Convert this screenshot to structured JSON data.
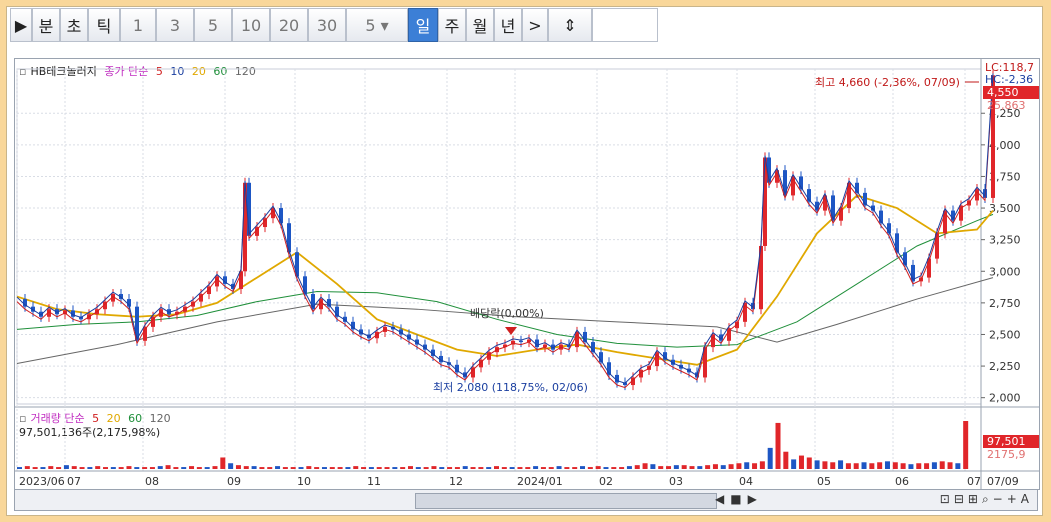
{
  "toolbar": {
    "items": [
      {
        "label": "▶",
        "active": false
      },
      {
        "label": "분",
        "active": false
      },
      {
        "label": "초",
        "active": false
      },
      {
        "label": "틱",
        "active": false
      },
      {
        "label": "1",
        "active": false
      },
      {
        "label": "3",
        "active": false
      },
      {
        "label": "5",
        "active": false
      },
      {
        "label": "10",
        "active": false
      },
      {
        "label": "20",
        "active": false
      },
      {
        "label": "30",
        "active": false
      },
      {
        "label": "5",
        "active": false
      },
      {
        "label": "일",
        "active": true
      },
      {
        "label": "주",
        "active": false
      },
      {
        "label": "월",
        "active": false
      },
      {
        "label": "년",
        "active": false
      },
      {
        "label": ">",
        "active": false
      },
      {
        "label": "⇕",
        "active": false
      }
    ]
  },
  "price_legend": {
    "title": "HB테크놀러지",
    "ma_label": "종가 단순",
    "periods": [
      "5",
      "10",
      "20",
      "60",
      "120"
    ],
    "colors": [
      "#d01f1f",
      "#1b3fa0",
      "#e0a800",
      "#1f8f3a",
      "#666666"
    ]
  },
  "volume_legend": {
    "title": "거래량 단순",
    "periods": [
      "5",
      "20",
      "60",
      "120"
    ],
    "value": "97,501,136주(2,175,98%)"
  },
  "annotations": {
    "high": "최고 4,660 (-2,36%, 07/09)",
    "low": "최저 2,080 (118,75%, 02/06)",
    "dividend": "배당락(0,00%)"
  },
  "right_labels": {
    "lc": "LC:118,7",
    "hc": "HC:-2,36",
    "price_now": "4,550",
    "pct": "25,863",
    "vol_now": "97,501",
    "vol_pct": "2175,9"
  },
  "colors": {
    "up": "#e0262a",
    "down": "#1d56c4",
    "grid": "#d9dde5"
  },
  "chart_data": {
    "type": "line",
    "y_ticks": [
      "4,250",
      "4,000",
      "3,750",
      "3,500",
      "3,250",
      "3,000",
      "2,750",
      "2,500",
      "2,250",
      "2,000"
    ],
    "ylim": [
      1950,
      4600
    ],
    "x_labels": [
      "2023/06",
      "07",
      "08",
      "09",
      "10",
      "11",
      "12",
      "2024/01",
      "02",
      "03",
      "04",
      "05",
      "06",
      "07",
      "07/09"
    ],
    "price_series": [
      [
        0,
        2780
      ],
      [
        8,
        2720
      ],
      [
        16,
        2680
      ],
      [
        24,
        2640
      ],
      [
        32,
        2700
      ],
      [
        40,
        2660
      ],
      [
        48,
        2690
      ],
      [
        56,
        2640
      ],
      [
        64,
        2620
      ],
      [
        72,
        2660
      ],
      [
        80,
        2700
      ],
      [
        88,
        2760
      ],
      [
        96,
        2820
      ],
      [
        104,
        2780
      ],
      [
        112,
        2720
      ],
      [
        120,
        2450
      ],
      [
        128,
        2560
      ],
      [
        136,
        2640
      ],
      [
        144,
        2700
      ],
      [
        152,
        2660
      ],
      [
        160,
        2680
      ],
      [
        168,
        2720
      ],
      [
        176,
        2760
      ],
      [
        184,
        2820
      ],
      [
        192,
        2880
      ],
      [
        200,
        2960
      ],
      [
        208,
        2900
      ],
      [
        216,
        2860
      ],
      [
        224,
        3000
      ],
      [
        228,
        3700
      ],
      [
        232,
        3280
      ],
      [
        240,
        3350
      ],
      [
        248,
        3420
      ],
      [
        256,
        3500
      ],
      [
        264,
        3380
      ],
      [
        272,
        3150
      ],
      [
        280,
        2960
      ],
      [
        288,
        2820
      ],
      [
        296,
        2700
      ],
      [
        304,
        2780
      ],
      [
        312,
        2720
      ],
      [
        320,
        2640
      ],
      [
        328,
        2600
      ],
      [
        336,
        2540
      ],
      [
        344,
        2500
      ],
      [
        352,
        2470
      ],
      [
        360,
        2520
      ],
      [
        368,
        2560
      ],
      [
        376,
        2540
      ],
      [
        384,
        2500
      ],
      [
        392,
        2460
      ],
      [
        400,
        2420
      ],
      [
        408,
        2380
      ],
      [
        416,
        2330
      ],
      [
        424,
        2280
      ],
      [
        432,
        2260
      ],
      [
        440,
        2200
      ],
      [
        448,
        2160
      ],
      [
        456,
        2240
      ],
      [
        464,
        2300
      ],
      [
        472,
        2360
      ],
      [
        480,
        2400
      ],
      [
        488,
        2420
      ],
      [
        496,
        2450
      ],
      [
        504,
        2440
      ],
      [
        512,
        2460
      ],
      [
        520,
        2400
      ],
      [
        528,
        2420
      ],
      [
        536,
        2380
      ],
      [
        544,
        2420
      ],
      [
        552,
        2400
      ],
      [
        560,
        2520
      ],
      [
        568,
        2440
      ],
      [
        576,
        2360
      ],
      [
        584,
        2280
      ],
      [
        592,
        2180
      ],
      [
        600,
        2120
      ],
      [
        608,
        2100
      ],
      [
        616,
        2160
      ],
      [
        624,
        2220
      ],
      [
        632,
        2250
      ],
      [
        640,
        2360
      ],
      [
        648,
        2300
      ],
      [
        656,
        2260
      ],
      [
        664,
        2230
      ],
      [
        672,
        2200
      ],
      [
        680,
        2160
      ],
      [
        688,
        2400
      ],
      [
        696,
        2500
      ],
      [
        704,
        2450
      ],
      [
        712,
        2550
      ],
      [
        720,
        2600
      ],
      [
        728,
        2750
      ],
      [
        736,
        2700
      ],
      [
        744,
        3200
      ],
      [
        748,
        3900
      ],
      [
        752,
        3700
      ],
      [
        760,
        3800
      ],
      [
        768,
        3600
      ],
      [
        776,
        3750
      ],
      [
        784,
        3650
      ],
      [
        792,
        3550
      ],
      [
        800,
        3480
      ],
      [
        808,
        3600
      ],
      [
        816,
        3400
      ],
      [
        824,
        3500
      ],
      [
        832,
        3700
      ],
      [
        840,
        3620
      ],
      [
        848,
        3520
      ],
      [
        856,
        3480
      ],
      [
        864,
        3380
      ],
      [
        872,
        3300
      ],
      [
        880,
        3150
      ],
      [
        888,
        3050
      ],
      [
        896,
        2920
      ],
      [
        904,
        2950
      ],
      [
        912,
        3100
      ],
      [
        920,
        3300
      ],
      [
        928,
        3480
      ],
      [
        936,
        3400
      ],
      [
        944,
        3520
      ],
      [
        952,
        3560
      ],
      [
        960,
        3650
      ],
      [
        968,
        3580
      ],
      [
        976,
        4550
      ]
    ],
    "ma20": [
      [
        0,
        2800
      ],
      [
        40,
        2700
      ],
      [
        80,
        2660
      ],
      [
        120,
        2640
      ],
      [
        160,
        2660
      ],
      [
        200,
        2750
      ],
      [
        240,
        2950
      ],
      [
        280,
        3150
      ],
      [
        320,
        2900
      ],
      [
        360,
        2620
      ],
      [
        400,
        2500
      ],
      [
        440,
        2380
      ],
      [
        480,
        2330
      ],
      [
        520,
        2380
      ],
      [
        560,
        2420
      ],
      [
        600,
        2360
      ],
      [
        640,
        2310
      ],
      [
        680,
        2260
      ],
      [
        720,
        2380
      ],
      [
        760,
        2800
      ],
      [
        800,
        3300
      ],
      [
        840,
        3600
      ],
      [
        880,
        3500
      ],
      [
        920,
        3300
      ],
      [
        960,
        3330
      ],
      [
        976,
        3480
      ]
    ],
    "ma60": [
      [
        0,
        2540
      ],
      [
        60,
        2580
      ],
      [
        120,
        2600
      ],
      [
        180,
        2650
      ],
      [
        240,
        2760
      ],
      [
        300,
        2840
      ],
      [
        360,
        2830
      ],
      [
        420,
        2760
      ],
      [
        480,
        2620
      ],
      [
        540,
        2500
      ],
      [
        600,
        2430
      ],
      [
        660,
        2400
      ],
      [
        720,
        2420
      ],
      [
        780,
        2600
      ],
      [
        840,
        2900
      ],
      [
        900,
        3200
      ],
      [
        960,
        3400
      ],
      [
        976,
        3450
      ]
    ],
    "ma120": [
      [
        0,
        2270
      ],
      [
        100,
        2420
      ],
      [
        200,
        2600
      ],
      [
        300,
        2740
      ],
      [
        400,
        2700
      ],
      [
        500,
        2640
      ],
      [
        600,
        2600
      ],
      [
        700,
        2560
      ],
      [
        760,
        2440
      ],
      [
        820,
        2580
      ],
      [
        900,
        2780
      ],
      [
        976,
        2950
      ]
    ],
    "volume": [
      2,
      3,
      2,
      2,
      3,
      2,
      4,
      3,
      2,
      2,
      3,
      2,
      2,
      2,
      3,
      2,
      2,
      2,
      3,
      4,
      2,
      2,
      3,
      2,
      2,
      3,
      12,
      6,
      4,
      3,
      3,
      2,
      2,
      3,
      2,
      2,
      2,
      3,
      2,
      2,
      2,
      2,
      2,
      3,
      2,
      2,
      2,
      2,
      2,
      2,
      3,
      2,
      2,
      3,
      2,
      2,
      2,
      3,
      2,
      2,
      2,
      3,
      2,
      2,
      2,
      2,
      3,
      2,
      2,
      3,
      2,
      2,
      3,
      2,
      3,
      2,
      2,
      2,
      3,
      4,
      6,
      5,
      3,
      3,
      4,
      4,
      3,
      3,
      4,
      5,
      4,
      5,
      6,
      7,
      6,
      8,
      22,
      48,
      18,
      10,
      14,
      12,
      9,
      8,
      7,
      9,
      6,
      6,
      7,
      6,
      7,
      8,
      7,
      6,
      5,
      6,
      6,
      7,
      8,
      7,
      6,
      50
    ]
  }
}
